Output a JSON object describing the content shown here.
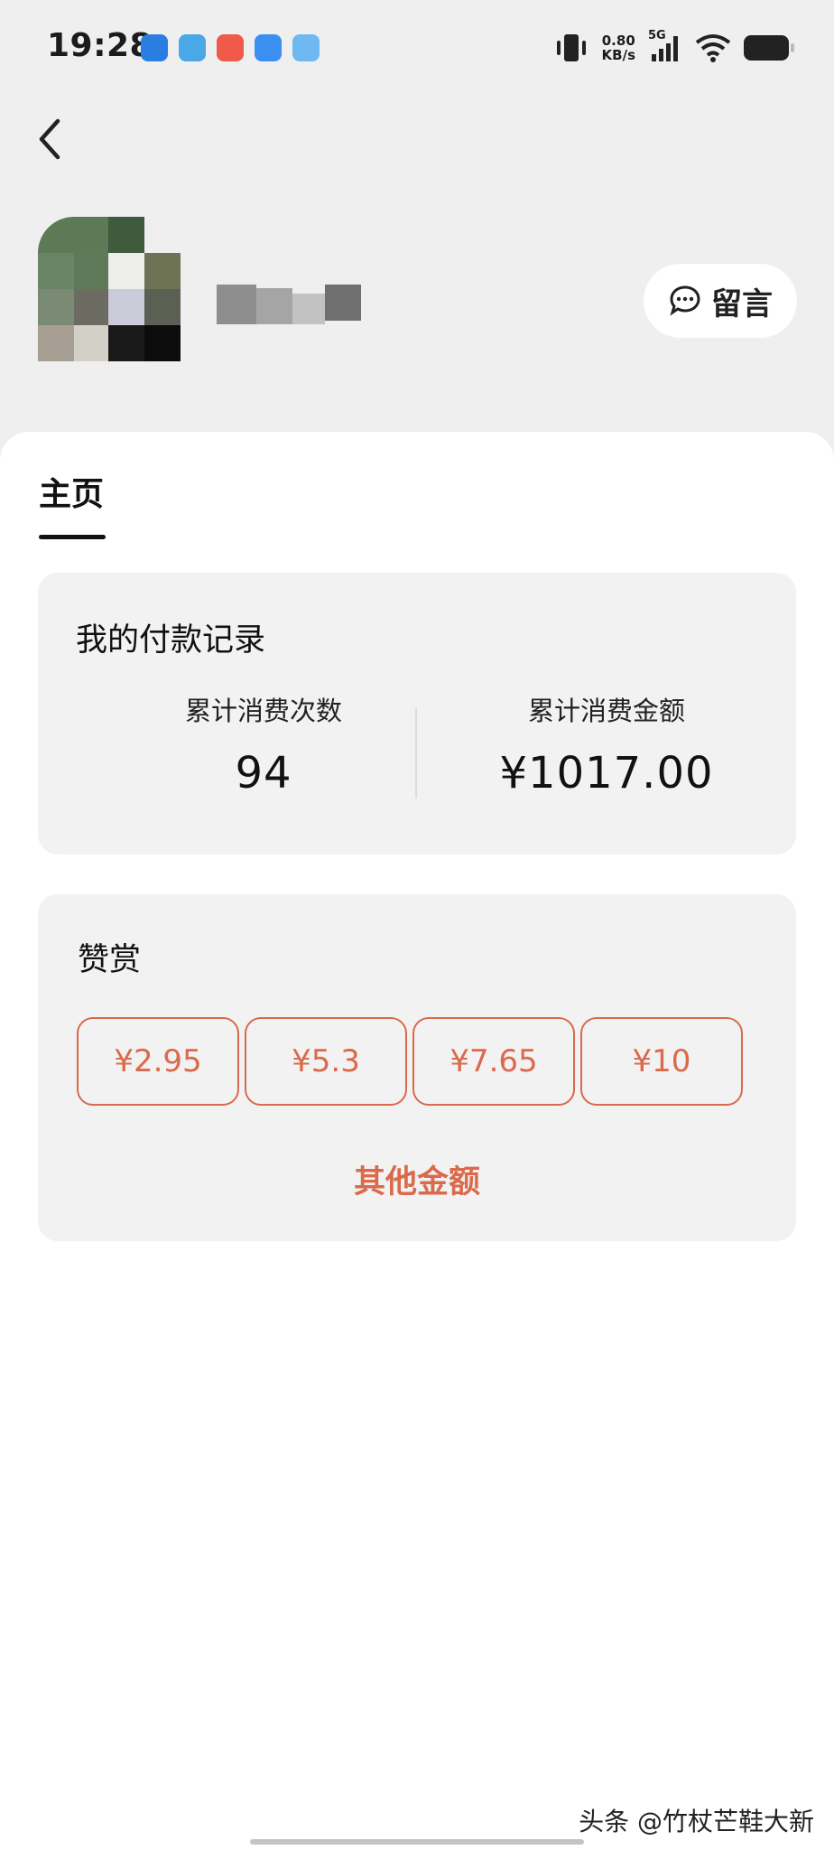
{
  "status_bar": {
    "time": "19:28",
    "net_speed_value": "0.80",
    "net_speed_unit": "KB/s",
    "signal_label": "5G",
    "notification_icons": [
      "browser-icon",
      "telegram-icon",
      "shop-icon",
      "chat-icon",
      "message-icon"
    ]
  },
  "header": {
    "back_icon": "chevron-left-icon",
    "message_button_label": "留言",
    "message_icon": "chat-bubble-icon"
  },
  "tabs": [
    {
      "label": "主页",
      "active": true
    }
  ],
  "payment_record": {
    "title": "我的付款记录",
    "count_label": "累计消费次数",
    "count_value": "94",
    "amount_label": "累计消费金额",
    "amount_value": "¥1017.00"
  },
  "reward": {
    "title": "赞赏",
    "amounts": [
      "¥2.95",
      "¥5.3",
      "¥7.65",
      "¥10"
    ],
    "other_label": "其他金额"
  },
  "watermark": "头条 @竹杖芒鞋大新",
  "colors": {
    "accent": "#d96a4b",
    "page_bg": "#efefef",
    "card_bg": "#f2f2f2"
  }
}
